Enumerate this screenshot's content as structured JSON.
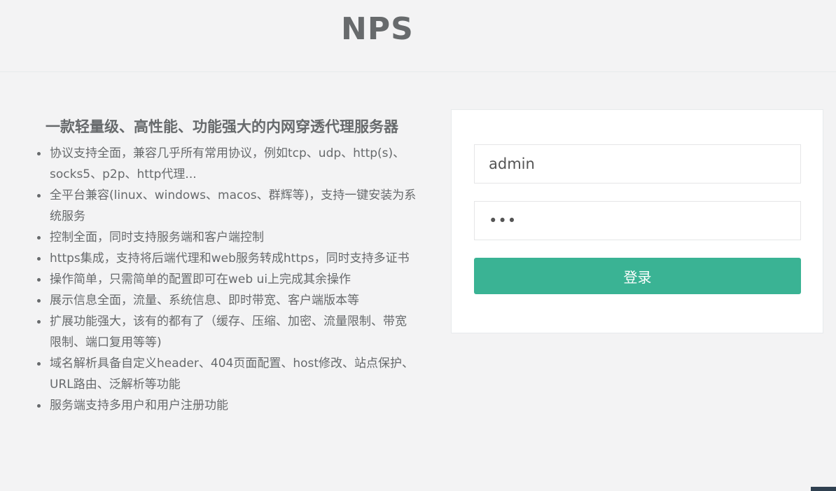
{
  "header": {
    "logo": "NPS"
  },
  "intro": {
    "title": "一款轻量级、高性能、功能强大的内网穿透代理服务器",
    "features": [
      "协议支持全面，兼容几乎所有常用协议，例如tcp、udp、http(s)、socks5、p2p、http代理...",
      "全平台兼容(linux、windows、macos、群辉等)，支持一键安装为系统服务",
      "控制全面，同时支持服务端和客户端控制",
      "https集成，支持将后端代理和web服务转成https，同时支持多证书",
      "操作简单，只需简单的配置即可在web ui上完成其余操作",
      "展示信息全面，流量、系统信息、即时带宽、客户端版本等",
      "扩展功能强大，该有的都有了（缓存、压缩、加密、流量限制、带宽限制、端口复用等等)",
      "域名解析具备自定义header、404页面配置、host修改、站点保护、URL路由、泛解析等功能",
      "服务端支持多用户和用户注册功能"
    ]
  },
  "login": {
    "username_value": "admin",
    "password_value": "•••",
    "submit_label": "登录"
  },
  "colors": {
    "accent": "#3ab394",
    "text": "#676a6c",
    "background": "#f3f3f4"
  }
}
